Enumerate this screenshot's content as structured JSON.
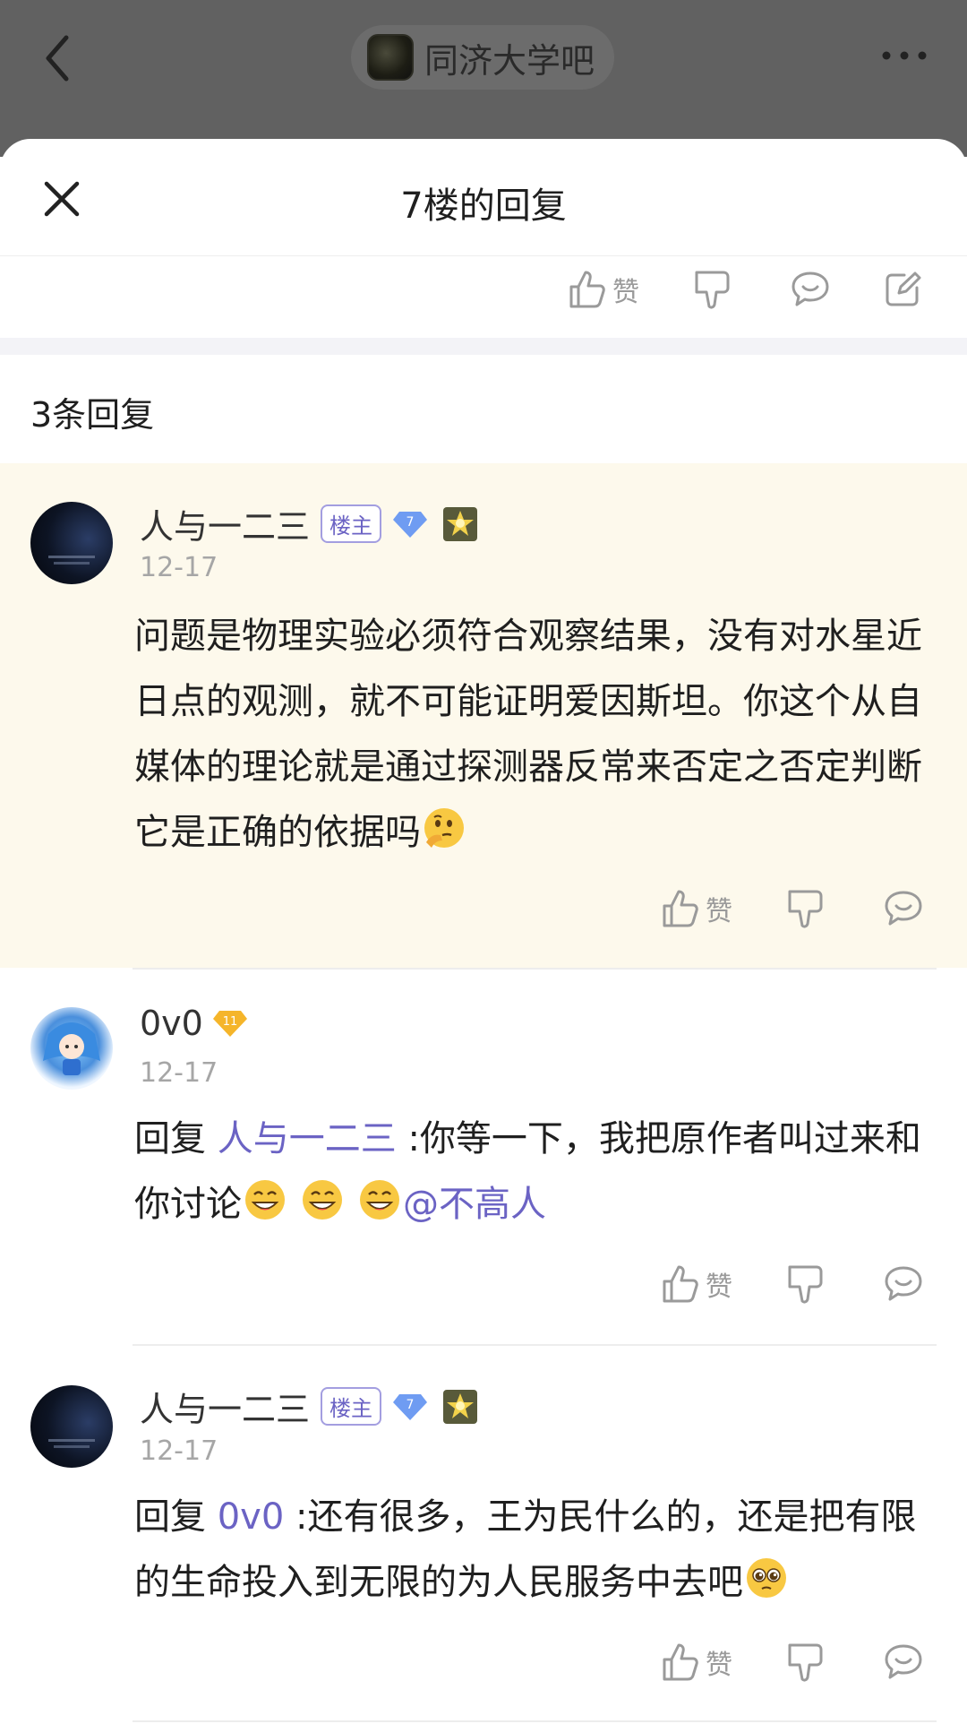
{
  "topbar": {
    "back_icon": "chevron-left-icon",
    "forum_name": "同济大学吧",
    "more_icon": "more-dots-icon"
  },
  "sheet": {
    "title": "7楼的回复",
    "close_icon": "close-icon"
  },
  "post_actions": {
    "like_label": "赞",
    "dislike_icon": "thumb-down-icon",
    "comment_icon": "comment-icon",
    "share_icon": "edit-share-icon"
  },
  "reply_count": "3条回复",
  "comments": [
    {
      "username": "人与一二三",
      "owner_badge": "楼主",
      "level": "7",
      "date": "12-17",
      "text": "问题是物理实验必须符合观察结果，没有对水星近日点的观测，就不可能证明爱因斯坦。你这个从自媒体的理论就是通过探测器反常来否定之否定判断它是正确的依据吗",
      "emoji": "thinking-face-icon",
      "like_label": "赞"
    },
    {
      "username": "0v0",
      "level": "11",
      "date": "12-17",
      "reply_prefix": "回复",
      "reply_to": "人与一二三",
      "text": ":你等一下，我把原作者叫过来和你讨论",
      "emojis": [
        "grin-face-icon",
        "grin-face-icon",
        "grin-face-icon"
      ],
      "mention": "@不高人",
      "like_label": "赞"
    },
    {
      "username": "人与一二三",
      "owner_badge": "楼主",
      "level": "7",
      "date": "12-17",
      "reply_prefix": "回复",
      "reply_to": "0v0",
      "text": ":还有很多，王为民什么的，还是把有限的生命投入到无限的为人民服务中去吧",
      "emoji": "pleading-face-icon",
      "like_label": "赞"
    }
  ],
  "colors": {
    "topbar_bg": "#616161",
    "highlight_bg": "#fdf9ec",
    "mention": "#6b63c4",
    "muted": "#a6a6a6"
  }
}
